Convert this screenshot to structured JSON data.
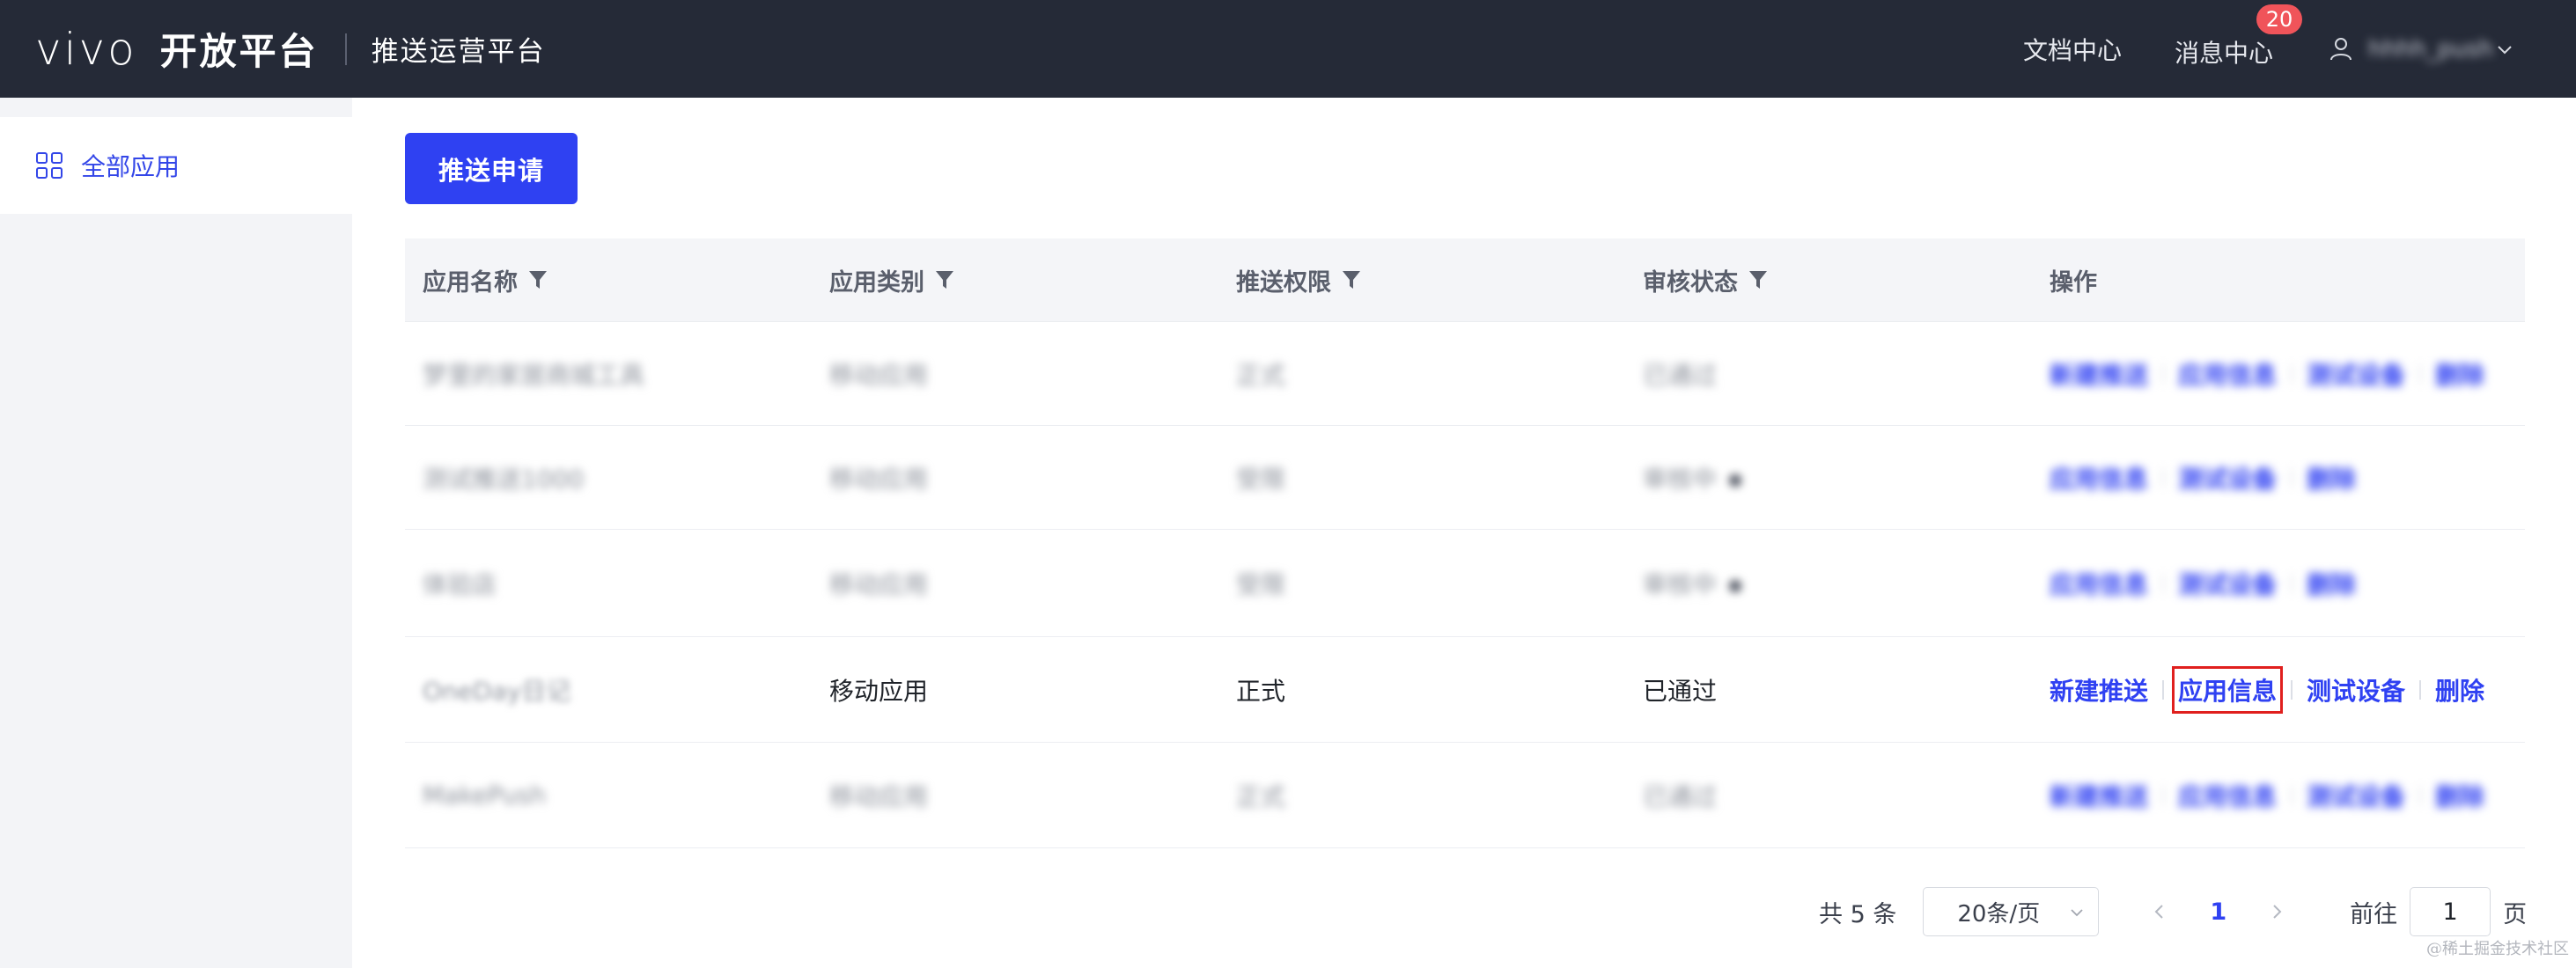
{
  "header": {
    "logo": "vivo",
    "brand": "开放平台",
    "platform": "推送运营平台",
    "nav": {
      "docs": "文档中心",
      "messages": "消息中心",
      "message_badge": "20"
    },
    "username": "hhhh_push"
  },
  "sidebar": {
    "items": [
      {
        "label": "全部应用",
        "icon": "grid-icon"
      }
    ]
  },
  "toolbar": {
    "push_apply": "推送申请"
  },
  "table": {
    "headers": [
      "应用名称",
      "应用类别",
      "推送权限",
      "审核状态",
      "操作"
    ],
    "rows": [
      {
        "name": "梦里的家居商城工具",
        "category": "移动应用",
        "permission": "正式",
        "status": "已通过",
        "ops": [
          "新建推送",
          "应用信息",
          "测试设备",
          "删除"
        ],
        "blurred": true
      },
      {
        "name": "测试推送1000",
        "category": "移动应用",
        "permission": "受限",
        "status": "审核中",
        "ops": [
          "应用信息",
          "测试设备",
          "删除"
        ],
        "blurred": true
      },
      {
        "name": "体验店",
        "category": "移动应用",
        "permission": "受限",
        "status": "审核中",
        "ops": [
          "应用信息",
          "测试设备",
          "删除"
        ],
        "blurred": true
      },
      {
        "name": "OneDay日记",
        "category": "移动应用",
        "permission": "正式",
        "status": "已通过",
        "ops": [
          "新建推送",
          "应用信息",
          "测试设备",
          "删除"
        ],
        "blurred": false
      },
      {
        "name": "MakePush",
        "category": "移动应用",
        "permission": "正式",
        "status": "已通过",
        "ops": [
          "新建推送",
          "应用信息",
          "测试设备",
          "删除"
        ],
        "blurred": true
      }
    ]
  },
  "pagination": {
    "total": "共 5 条",
    "page_size": "20条/页",
    "current_page": "1",
    "goto_label": "前往",
    "goto_value": "1",
    "page_unit": "页"
  },
  "watermark": "@稀土掘金技术社区",
  "colors": {
    "topbar": "#252a37",
    "accent": "#2f41f2",
    "badge": "#f0545a",
    "highlight_border": "#e0201e"
  }
}
